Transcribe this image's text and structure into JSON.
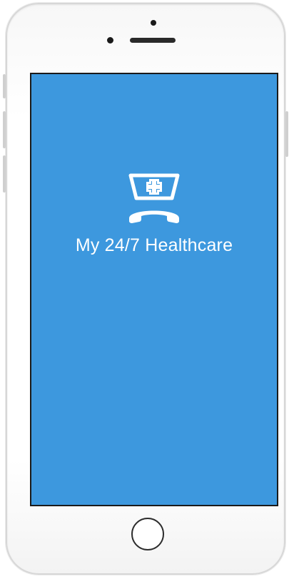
{
  "app": {
    "title": "My 24/7 Healthcare"
  },
  "icons": {
    "logo": "nurse-cap-phone-icon"
  },
  "colors": {
    "screen_background": "#3d98de",
    "title_text": "#ffffff",
    "logo": "#ffffff"
  }
}
